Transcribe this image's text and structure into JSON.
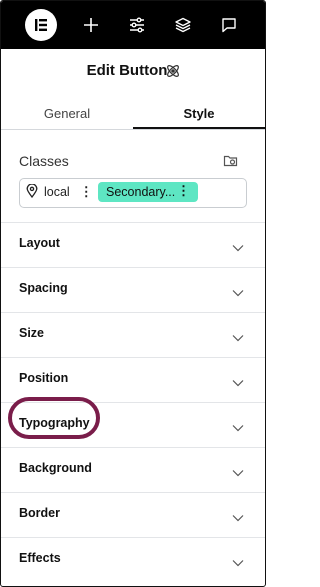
{
  "topbar": {
    "icons": [
      "elementor-logo-icon",
      "plus-icon",
      "sliders-icon",
      "layers-icon",
      "chat-icon"
    ]
  },
  "header": {
    "title": "Edit Button",
    "icon": "atom-icon"
  },
  "tabs": [
    {
      "label": "General",
      "active": false
    },
    {
      "label": "Style",
      "active": true
    }
  ],
  "classes": {
    "label": "Classes",
    "chips": [
      {
        "label": "local",
        "icon": "location-pin-icon"
      },
      {
        "label": "Secondary...",
        "color": "#5ee6c3"
      }
    ]
  },
  "sections": [
    {
      "label": "Layout"
    },
    {
      "label": "Spacing"
    },
    {
      "label": "Size"
    },
    {
      "label": "Position"
    },
    {
      "label": "Typography",
      "highlighted": true
    },
    {
      "label": "Background"
    },
    {
      "label": "Border"
    },
    {
      "label": "Effects"
    }
  ],
  "colors": {
    "topbar": "#000000",
    "chip_accent": "#5ee6c3",
    "highlight_ring": "#7a1d4a"
  }
}
